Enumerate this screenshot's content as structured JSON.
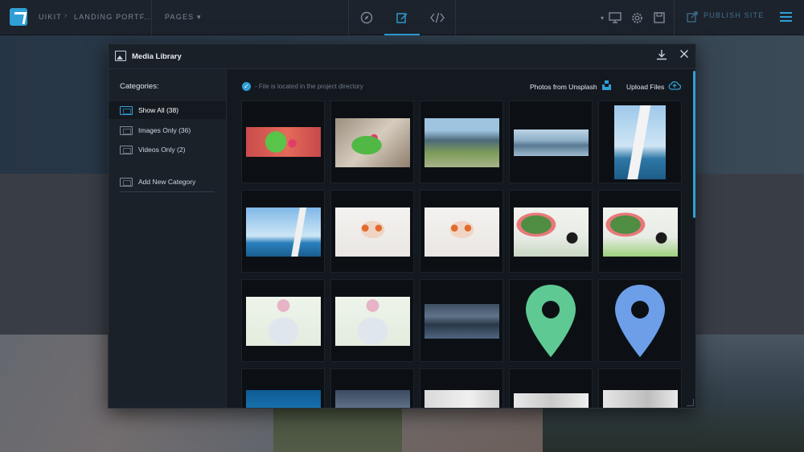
{
  "topbar": {
    "breadcrumb": [
      "UIKIT",
      "LANDING PORTF..."
    ],
    "pages_menu": "PAGES",
    "publish_label": "PUBLISH SITE",
    "accent": "#2f9fd6",
    "modes": [
      "compass-icon",
      "edit-icon",
      "code-icon"
    ],
    "active_mode": "edit-icon",
    "tools": [
      "device-monitor-icon",
      "gear-icon",
      "save-icon"
    ]
  },
  "modal": {
    "title": "Media Library",
    "sidebar": {
      "heading": "Categories:",
      "items": [
        {
          "label": "Show All (38)",
          "icon": "all-media-icon",
          "active": true
        },
        {
          "label": "Images Only (36)",
          "icon": "image-icon",
          "active": false
        },
        {
          "label": "Videos Only (2)",
          "icon": "video-icon",
          "active": false
        }
      ],
      "add_category": "Add New Category"
    },
    "toolbar": {
      "info": "- File is located in the project directory",
      "unsplash": "Photos from Unsplash",
      "upload": "Upload Files"
    },
    "media": [
      {
        "name": "smoothie-top",
        "kind": "photo"
      },
      {
        "name": "smoothie-jar",
        "kind": "photo"
      },
      {
        "name": "mountains-road",
        "kind": "photo"
      },
      {
        "name": "mountain-lake",
        "kind": "photo"
      },
      {
        "name": "sailboat-portrait",
        "kind": "photo"
      },
      {
        "name": "sailboat-landscape",
        "kind": "photo"
      },
      {
        "name": "woman-sunglasses-1",
        "kind": "photo"
      },
      {
        "name": "woman-sunglasses-2",
        "kind": "photo"
      },
      {
        "name": "leaf-sunglasses-1",
        "kind": "photo"
      },
      {
        "name": "leaf-sunglasses-2",
        "kind": "photo"
      },
      {
        "name": "woman-pink-hair-1",
        "kind": "photo"
      },
      {
        "name": "woman-pink-hair-2",
        "kind": "photo"
      },
      {
        "name": "dusk-lake",
        "kind": "photo"
      },
      {
        "name": "map-pin-green",
        "kind": "icon",
        "color": "#5fc993"
      },
      {
        "name": "map-pin-blue",
        "kind": "icon",
        "color": "#6d9ee8"
      },
      {
        "name": "partial-1",
        "kind": "photo"
      },
      {
        "name": "partial-2",
        "kind": "photo"
      },
      {
        "name": "partial-3",
        "kind": "photo"
      },
      {
        "name": "partial-4",
        "kind": "photo"
      },
      {
        "name": "partial-5",
        "kind": "photo"
      }
    ]
  }
}
